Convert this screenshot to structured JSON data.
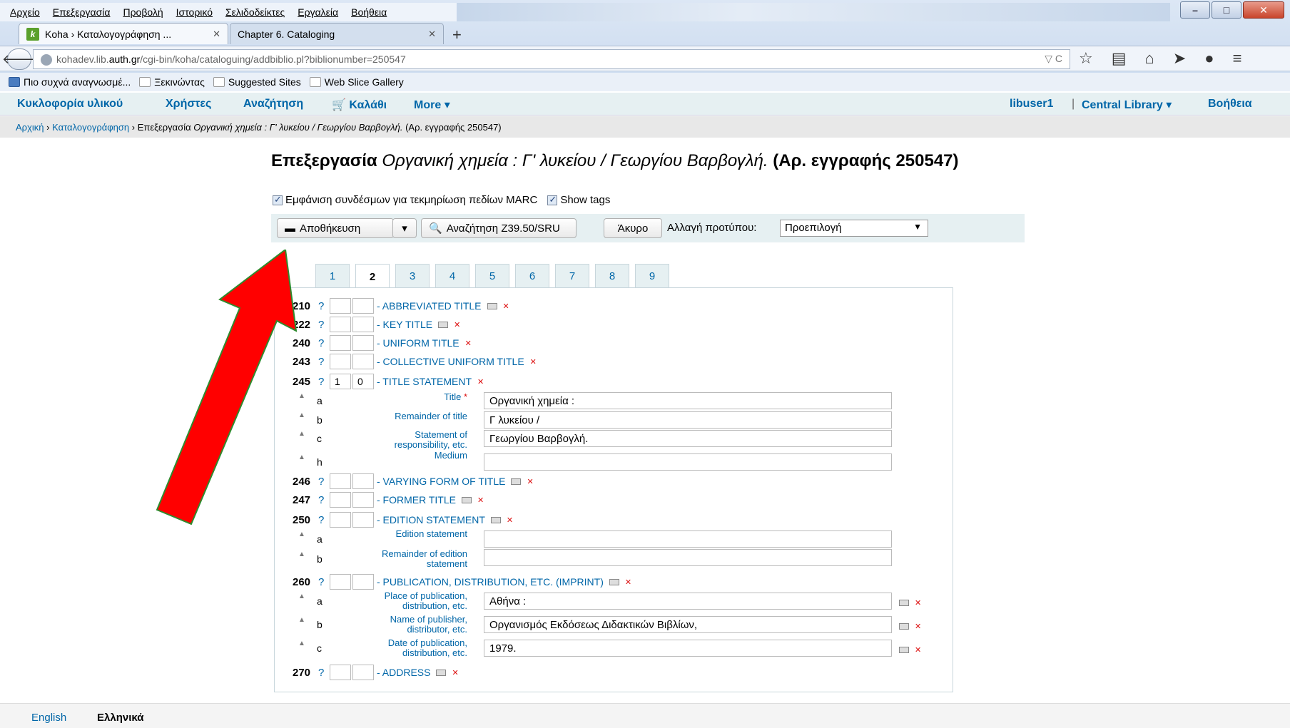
{
  "browser": {
    "menu": [
      "Αρχείο",
      "Επεξεργασία",
      "Προβολή",
      "Ιστορικό",
      "Σελιδοδείκτες",
      "Εργαλεία",
      "Βοήθεια"
    ],
    "tabs": [
      {
        "label": "Koha › Καταλογογράφηση ..."
      },
      {
        "label": "Chapter 6. Cataloging"
      }
    ],
    "url_prefix": "kohadev.lib.",
    "url_domain": "auth.gr",
    "url_path": "/cgi-bin/koha/cataloguing/addbiblio.pl?biblionumber=250547",
    "bookmarks": [
      "Πιο συχνά αναγνωσμέ...",
      "Ξεκινώντας",
      "Suggested Sites",
      "Web Slice Gallery"
    ]
  },
  "koha_nav": {
    "circulation": "Κυκλοφορία υλικού",
    "patrons": "Χρήστες",
    "search": "Αναζήτηση",
    "cart": "Καλάθι",
    "more": "More",
    "user": "libuser1",
    "library": "Central Library",
    "help": "Βοήθεια"
  },
  "breadcrumbs": {
    "home": "Αρχική",
    "cataloging": "Καταλογογράφηση",
    "edit": "Επεξεργασία",
    "title_italic": "Οργανική χημεία : Γ' λυκείου / Γεωργίου Βαρβογλή.",
    "record": "(Αρ. εγγραφής 250547)"
  },
  "page": {
    "title_prefix": "Επεξεργασία",
    "title_italic": "Οργανική χημεία : Γ' λυκείου / Γεωργίου Βαρβογλή.",
    "title_suffix": "(Αρ. εγγραφής 250547)",
    "check_marc": "Εμφάνιση συνδέσμων για τεκμηρίωση πεδίων MARC",
    "check_tags": "Show tags"
  },
  "toolbar": {
    "save": "Αποθήκευση",
    "z3950": "Αναζήτηση Z39.50/SRU",
    "cancel": "Άκυρο",
    "template_label": "Αλλαγή προτύπου:",
    "template_value": "Προεπιλογή"
  },
  "field_tabs": [
    "1",
    "2",
    "3",
    "4",
    "5",
    "6",
    "7",
    "8",
    "9"
  ],
  "tags": {
    "t210": {
      "num": "210",
      "q": "?",
      "ind1": "",
      "ind2": "",
      "label": "- ABBREVIATED TITLE"
    },
    "t222": {
      "num": "222",
      "q": "?",
      "ind1": "",
      "ind2": "",
      "label": "- KEY TITLE"
    },
    "t240": {
      "num": "240",
      "q": "?",
      "ind1": "",
      "ind2": "",
      "label": "- UNIFORM TITLE"
    },
    "t243": {
      "num": "243",
      "q": "?",
      "ind1": "",
      "ind2": "",
      "label": "- COLLECTIVE UNIFORM TITLE"
    },
    "t245": {
      "num": "245",
      "q": "?",
      "ind1": "1",
      "ind2": "0",
      "label": "- TITLE STATEMENT"
    },
    "t246": {
      "num": "246",
      "q": "?",
      "ind1": "",
      "ind2": "",
      "label": "- VARYING FORM OF TITLE"
    },
    "t247": {
      "num": "247",
      "q": "?",
      "ind1": "",
      "ind2": "",
      "label": "- FORMER TITLE"
    },
    "t250": {
      "num": "250",
      "q": "?",
      "ind1": "",
      "ind2": "",
      "label": "- EDITION STATEMENT"
    },
    "t260": {
      "num": "260",
      "q": "?",
      "ind1": "",
      "ind2": "",
      "label": "- PUBLICATION, DISTRIBUTION, ETC. (IMPRINT)"
    },
    "t270": {
      "num": "270",
      "q": "?",
      "ind1": "",
      "ind2": "",
      "label": "- ADDRESS"
    }
  },
  "subfields": {
    "s245a": {
      "code": "a",
      "label": "Title",
      "required": "*",
      "value": "Οργανική χημεία :"
    },
    "s245b": {
      "code": "b",
      "label": "Remainder of title",
      "value": "Γ λυκείου /"
    },
    "s245c": {
      "code": "c",
      "label1": "Statement of",
      "label2": "responsibility, etc.",
      "value": "Γεωργίου Βαρβογλή."
    },
    "s245h": {
      "code": "h",
      "label": "Medium",
      "value": ""
    },
    "s250a": {
      "code": "a",
      "label": "Edition statement",
      "value": ""
    },
    "s250b": {
      "code": "b",
      "label1": "Remainder of edition",
      "label2": "statement",
      "value": ""
    },
    "s260a": {
      "code": "a",
      "label1": "Place of publication,",
      "label2": "distribution, etc.",
      "value": "Αθήνα :"
    },
    "s260b": {
      "code": "b",
      "label1": "Name of publisher,",
      "label2": "distributor, etc.",
      "value": "Οργανισμός Εκδόσεως Διδακτικών Βιβλίων,"
    },
    "s260c": {
      "code": "c",
      "label1": "Date of publication,",
      "label2": "distribution, etc.",
      "value": "1979."
    }
  },
  "languages": {
    "english": "English",
    "greek": "Ελληνικά"
  },
  "colors": {
    "link": "#0066a8",
    "arrow_fill": "#ff0000",
    "arrow_stroke": "#2e8b2e"
  }
}
